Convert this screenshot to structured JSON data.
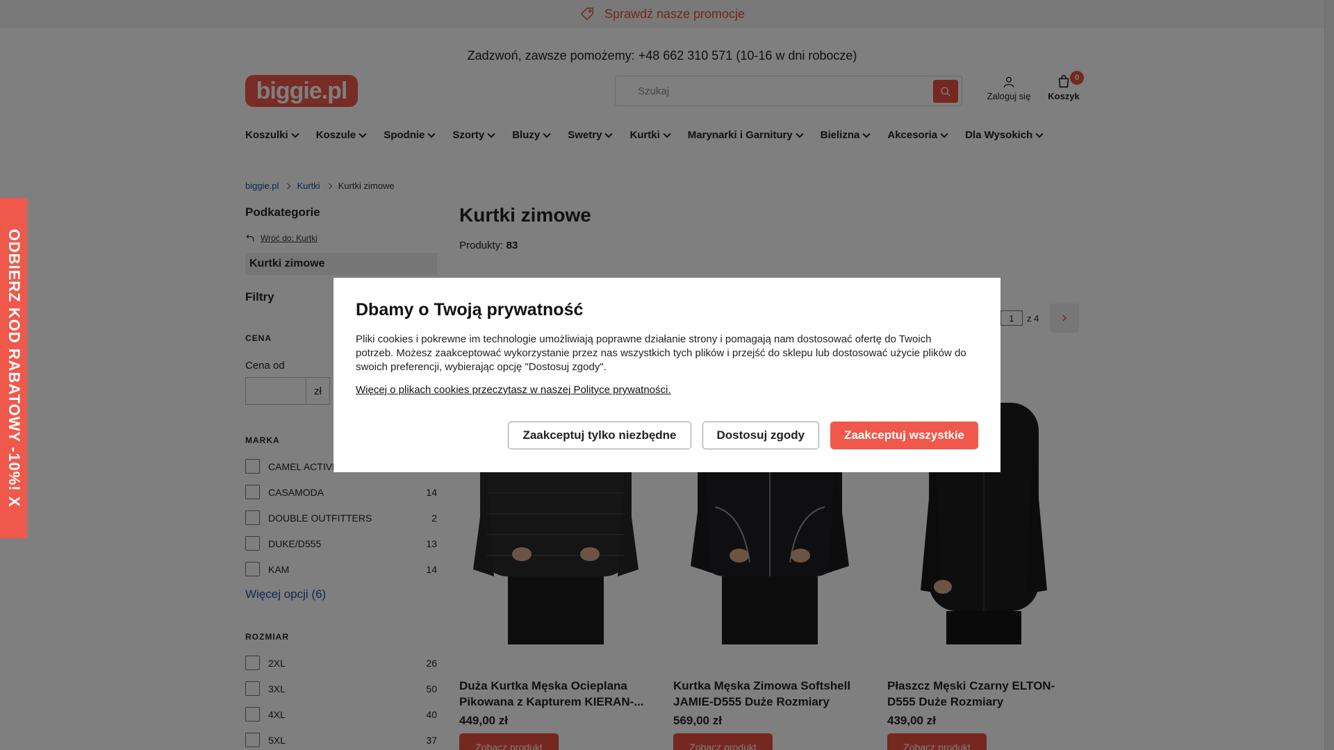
{
  "promo": {
    "text": "Sprawdź nasze promocje",
    "icon": "tag-icon"
  },
  "header": {
    "phone_text": "Zadzwoń, zawsze pomożemy: +48 662 310 571 (10-16 w dni robocze)",
    "logo": "biggie.pl",
    "search_placeholder": "Szukaj",
    "login_label": "Zaloguj się",
    "cart_label": "Koszyk",
    "cart_count": "0"
  },
  "nav": [
    "Koszulki",
    "Koszule",
    "Spodnie",
    "Szorty",
    "Bluzy",
    "Swetry",
    "Kurtki",
    "Marynarki i Garnitury",
    "Bielizna",
    "Akcesoria",
    "Dla Wysokich"
  ],
  "breadcrumb": [
    "biggie.pl",
    "Kurtki",
    "Kurtki zimowe"
  ],
  "sidebar": {
    "subcategories_title": "Podkategorie",
    "back_label": "Wróć do: Kurtki",
    "active_subcategory": "Kurtki zimowe",
    "filters_title": "Filtry",
    "price_heading": "CENA",
    "price_from_label": "Cena od",
    "price_unit": "zł",
    "brand_heading": "MARKA",
    "brands": [
      {
        "label": "CAMEL ACTIVE",
        "count": ""
      },
      {
        "label": "CASAMODA",
        "count": "14"
      },
      {
        "label": "DOUBLE OUTFITTERS",
        "count": "2"
      },
      {
        "label": "DUKE/D555",
        "count": "13"
      },
      {
        "label": "KAM",
        "count": "14"
      }
    ],
    "more_options": "Więcej opcji (6)",
    "size_heading": "ROZMIAR",
    "sizes": [
      {
        "label": "2XL",
        "count": "26"
      },
      {
        "label": "3XL",
        "count": "50"
      },
      {
        "label": "4XL",
        "count": "40"
      },
      {
        "label": "5XL",
        "count": "37"
      }
    ]
  },
  "main": {
    "title": "Kurtki zimowe",
    "count_label": "Produkty:",
    "count_value": "83",
    "page_current": "1",
    "page_total": "z 4"
  },
  "products": [
    {
      "name": "Duża Kurtka Męska Ocieplana Pikowana z Kapturem KIERAN-...",
      "price": "449,00 zł",
      "cta": "Zobacz produkt"
    },
    {
      "name": "Kurtka Męska Zimowa Softshell JAMIE-D555 Duże Rozmiary",
      "price": "569,00 zł",
      "cta": "Zobacz produkt"
    },
    {
      "name": "Płaszcz Męski Czarny ELTON-D555 Duże Rozmiary",
      "price": "439,00 zł",
      "cta": "Zobacz produkt"
    }
  ],
  "discount_tab": "ODBIERZ KOD RABATOWY -10%!  X",
  "cookie_modal": {
    "title": "Dbamy o Twoją prywatność",
    "body": "Pliki cookies i pokrewne im technologie umożliwiają poprawne działanie strony i pomagają nam dostosować ofertę do Twoich potrzeb. Możesz zaakceptować wykorzystanie przez nas wszystkich tych plików i przejść do sklepu lub dostosować użycie plików do swoich preferencji, wybierając opcję \"Dostosuj zgody\".",
    "policy_link": "Więcej o plikach cookies przeczytasz w naszej Polityce prywatności.",
    "btn_necessary": "Zaakceptuj tylko niezbędne",
    "btn_customize": "Dostosuj zgody",
    "btn_accept_all": "Zaakceptuj wszystkie"
  },
  "colors": {
    "accent": "#f0584b",
    "link": "#1f4ea3"
  }
}
